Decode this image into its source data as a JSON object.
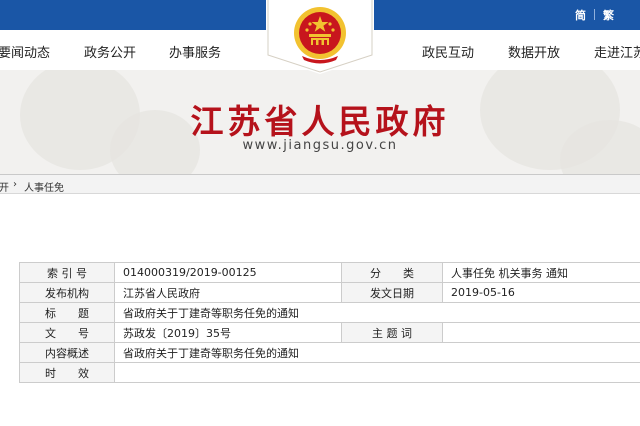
{
  "lang": {
    "simplified": "简",
    "traditional": "繁"
  },
  "nav": {
    "left": [
      "要闻动态",
      "政务公开",
      "办事服务"
    ],
    "right": [
      "政民互动",
      "数据开放",
      "走进江苏"
    ]
  },
  "banner": {
    "title": "江苏省人民政府",
    "url": "www.jiangsu.gov.cn"
  },
  "breadcrumb": {
    "parent": "开",
    "separator": "›",
    "current": "人事任免"
  },
  "info": {
    "index_no": {
      "label": "索 引 号",
      "value": "014000319/2019-00125"
    },
    "category": {
      "label": "分　　类",
      "value": "人事任免 机关事务 通知"
    },
    "issuer": {
      "label": "发布机构",
      "value": "江苏省人民政府"
    },
    "issue_date": {
      "label": "发文日期",
      "value": "2019-05-16"
    },
    "title": {
      "label": "标　　题",
      "value": "省政府关于丁建奇等职务任免的通知"
    },
    "doc_no": {
      "label": "文　　号",
      "value": "苏政发〔2019〕35号"
    },
    "keywords": {
      "label": "主 题 词",
      "value": ""
    },
    "summary": {
      "label": "内容概述",
      "value": "省政府关于丁建奇等职务任免的通知"
    },
    "validity": {
      "label": "时　　效",
      "value": ""
    }
  },
  "colors": {
    "top_bar": "#1a56a6",
    "title_red": "#b5121b",
    "emblem_red": "#c8161d",
    "emblem_gold": "#f2c230"
  }
}
